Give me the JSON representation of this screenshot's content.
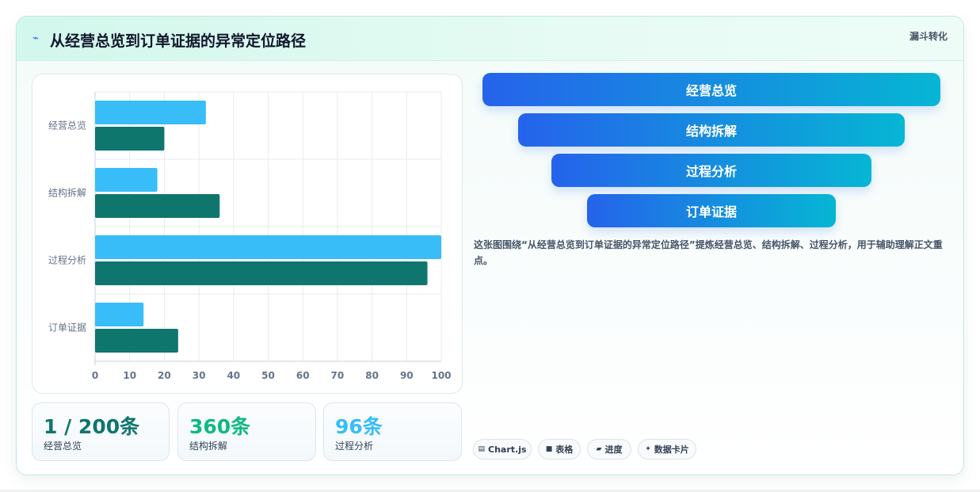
{
  "header": {
    "icon": "sparkle-icon",
    "title": "从经营总览到订单证据的异常定位路径",
    "tag": "漏斗转化"
  },
  "chart_data": {
    "type": "bar",
    "orientation": "horizontal",
    "categories": [
      "经营总览",
      "结构拆解",
      "过程分析",
      "订单证据"
    ],
    "series": [
      {
        "values": [
          32,
          18,
          100,
          14
        ],
        "color": "#38bdf8"
      },
      {
        "values": [
          20,
          36,
          96,
          24
        ],
        "color": "#0f766e"
      }
    ],
    "xlim": [
      0,
      100
    ],
    "xticks": [
      0,
      10,
      20,
      30,
      40,
      50,
      60,
      70,
      80,
      90,
      100
    ],
    "grid": true
  },
  "stats": [
    {
      "value": "1 / 200条",
      "label": "经营总览",
      "color": "#0f766e"
    },
    {
      "value": "360条",
      "label": "结构拆解",
      "color": "#10b981"
    },
    {
      "value": "96条",
      "label": "过程分析",
      "color": "#38bdf8"
    }
  ],
  "funnel": [
    "经营总览",
    "结构拆解",
    "过程分析",
    "订单证据"
  ],
  "description": "这张图围绕“从经营总览到订单证据的异常定位路径”提炼经营总览、结构拆解、过程分析，用于辅助理解正文重点。",
  "chips": [
    {
      "icon": "chart-icon",
      "glyph": "▤",
      "label": "Chart.js"
    },
    {
      "icon": "table-icon",
      "glyph": "■",
      "label": "表格"
    },
    {
      "icon": "progress-icon",
      "glyph": "▰",
      "label": "进度"
    },
    {
      "icon": "sparkle-icon",
      "glyph": "✦",
      "label": "数据卡片"
    }
  ]
}
